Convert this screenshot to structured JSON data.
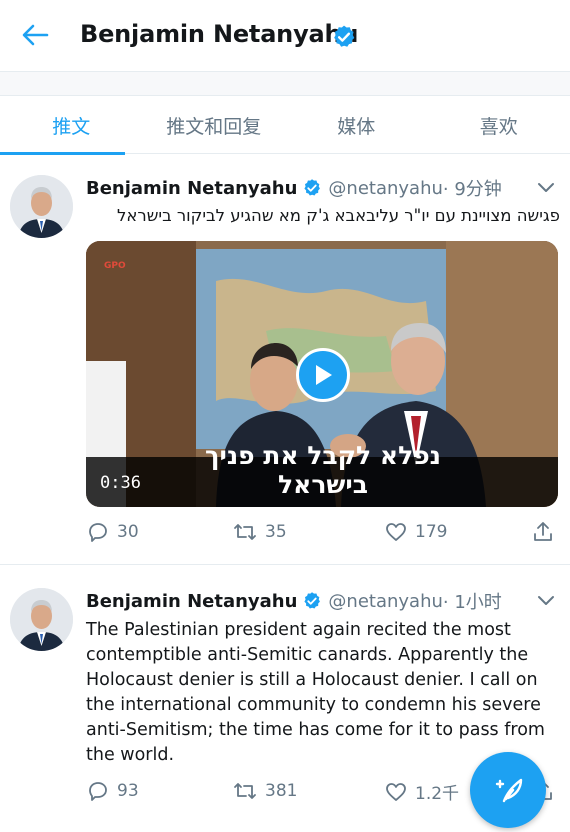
{
  "header": {
    "title": "Benjamin Netanyahu",
    "back_icon": "arrow-left-icon",
    "verified_icon": "verified-badge-icon"
  },
  "tabs": [
    {
      "label": "推文",
      "active": true
    },
    {
      "label": "推文和回复",
      "active": false
    },
    {
      "label": "媒体",
      "active": false
    },
    {
      "label": "喜欢",
      "active": false
    }
  ],
  "tweets": [
    {
      "name": "Benjamin Netanyahu",
      "handle": "@netanyahu",
      "time": " · 9分钟",
      "text": "פגישה מצויינת עם יו\"ר עליבאבא ג'ק מא שהגיע לביקור בישראל",
      "media": {
        "type": "video",
        "duration": "0:36",
        "caption": "נפלא לקבל את פניך בישראל",
        "logo_text": "GPO"
      },
      "actions": {
        "replies": "30",
        "retweets": "35",
        "likes": "179"
      }
    },
    {
      "name": "Benjamin Netanyahu",
      "handle": "@netanyahu",
      "time": " · 1小时",
      "text": "The Palestinian president again recited the most contemptible anti-Semitic canards. Apparently the Holocaust denier is still a Holocaust denier. I call on the international community to condemn his severe anti-Semitism; the time has come for it to pass from the world.",
      "actions": {
        "replies": "93",
        "retweets": "381",
        "likes": "1.2千"
      }
    }
  ],
  "fab": {
    "icon": "compose-feather-icon"
  },
  "colors": {
    "accent": "#1da1f2",
    "secondary_text": "#657786",
    "border": "#e6ecf0"
  }
}
